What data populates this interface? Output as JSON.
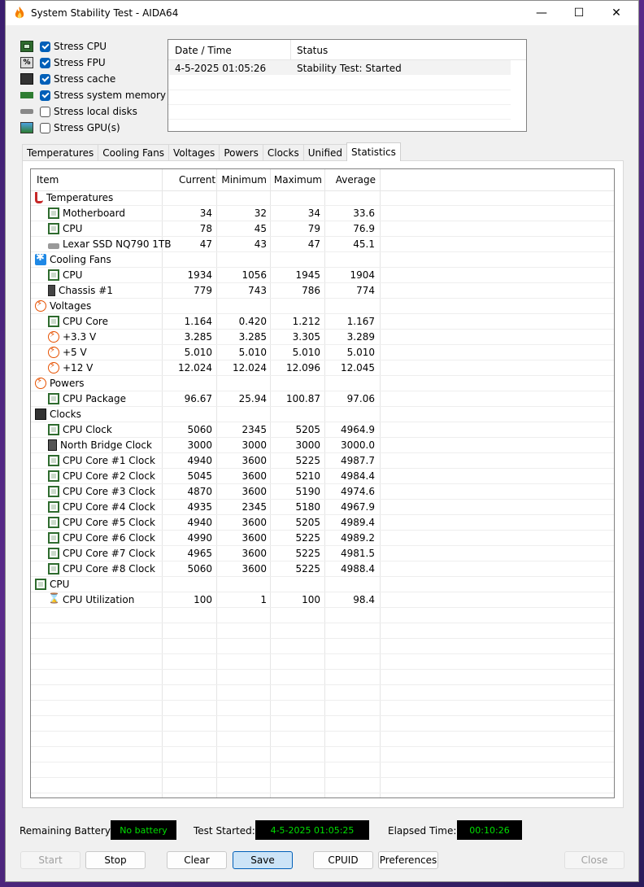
{
  "window": {
    "title": "System Stability Test - AIDA64",
    "min_glyph": "—",
    "max_glyph": "☐",
    "close_glyph": "✕"
  },
  "stress": [
    {
      "label": "Stress CPU",
      "checked": true,
      "icon": "cpu-chip-icon"
    },
    {
      "label": "Stress FPU",
      "checked": true,
      "icon": "fpu-icon"
    },
    {
      "label": "Stress cache",
      "checked": true,
      "icon": "cache-icon"
    },
    {
      "label": "Stress system memory",
      "checked": true,
      "icon": "memory-icon"
    },
    {
      "label": "Stress local disks",
      "checked": false,
      "icon": "disk-icon"
    },
    {
      "label": "Stress GPU(s)",
      "checked": false,
      "icon": "gpu-icon"
    }
  ],
  "status_table": {
    "headers": [
      "Date / Time",
      "Status"
    ],
    "rows": [
      {
        "datetime": "4-5-2025 01:05:26",
        "status": "Stability Test: Started"
      }
    ]
  },
  "tabs": [
    "Temperatures",
    "Cooling Fans",
    "Voltages",
    "Powers",
    "Clocks",
    "Unified",
    "Statistics"
  ],
  "active_tab": "Statistics",
  "stats": {
    "headers": [
      "Item",
      "Current",
      "Minimum",
      "Maximum",
      "Average"
    ],
    "rows": [
      {
        "name": "Temperatures",
        "icon": "therm",
        "indent": 0
      },
      {
        "name": "Motherboard",
        "icon": "chip",
        "indent": 1,
        "cur": "34",
        "min": "32",
        "max": "34",
        "avg": "33.6"
      },
      {
        "name": "CPU",
        "icon": "chip",
        "indent": 1,
        "cur": "78",
        "min": "45",
        "max": "79",
        "avg": "76.9"
      },
      {
        "name": "Lexar SSD NQ790 1TB",
        "icon": "disk",
        "indent": 1,
        "cur": "47",
        "min": "43",
        "max": "47",
        "avg": "45.1"
      },
      {
        "name": "Cooling Fans",
        "icon": "fan",
        "indent": 0
      },
      {
        "name": "CPU",
        "icon": "chip",
        "indent": 1,
        "cur": "1934",
        "min": "1056",
        "max": "1945",
        "avg": "1904"
      },
      {
        "name": "Chassis #1",
        "icon": "case",
        "indent": 1,
        "cur": "779",
        "min": "743",
        "max": "786",
        "avg": "774"
      },
      {
        "name": "Voltages",
        "icon": "bolt",
        "indent": 0
      },
      {
        "name": "CPU Core",
        "icon": "chip",
        "indent": 1,
        "cur": "1.164",
        "min": "0.420",
        "max": "1.212",
        "avg": "1.167"
      },
      {
        "name": "+3.3 V",
        "icon": "bolt",
        "indent": 1,
        "cur": "3.285",
        "min": "3.285",
        "max": "3.305",
        "avg": "3.289"
      },
      {
        "name": "+5 V",
        "icon": "bolt",
        "indent": 1,
        "cur": "5.010",
        "min": "5.010",
        "max": "5.010",
        "avg": "5.010"
      },
      {
        "name": "+12 V",
        "icon": "bolt",
        "indent": 1,
        "cur": "12.024",
        "min": "12.024",
        "max": "12.096",
        "avg": "12.045"
      },
      {
        "name": "Powers",
        "icon": "bolt",
        "indent": 0
      },
      {
        "name": "CPU Package",
        "icon": "chip",
        "indent": 1,
        "cur": "96.67",
        "min": "25.94",
        "max": "100.87",
        "avg": "97.06"
      },
      {
        "name": "Clocks",
        "icon": "clk",
        "indent": 0
      },
      {
        "name": "CPU Clock",
        "icon": "chip",
        "indent": 1,
        "cur": "5060",
        "min": "2345",
        "max": "5205",
        "avg": "4964.9"
      },
      {
        "name": "North Bridge Clock",
        "icon": "nb",
        "indent": 1,
        "cur": "3000",
        "min": "3000",
        "max": "3000",
        "avg": "3000.0"
      },
      {
        "name": "CPU Core #1 Clock",
        "icon": "chip",
        "indent": 1,
        "cur": "4940",
        "min": "3600",
        "max": "5225",
        "avg": "4987.7"
      },
      {
        "name": "CPU Core #2 Clock",
        "icon": "chip",
        "indent": 1,
        "cur": "5045",
        "min": "3600",
        "max": "5210",
        "avg": "4984.4"
      },
      {
        "name": "CPU Core #3 Clock",
        "icon": "chip",
        "indent": 1,
        "cur": "4870",
        "min": "3600",
        "max": "5190",
        "avg": "4974.6"
      },
      {
        "name": "CPU Core #4 Clock",
        "icon": "chip",
        "indent": 1,
        "cur": "4935",
        "min": "2345",
        "max": "5180",
        "avg": "4967.9"
      },
      {
        "name": "CPU Core #5 Clock",
        "icon": "chip",
        "indent": 1,
        "cur": "4940",
        "min": "3600",
        "max": "5205",
        "avg": "4989.4"
      },
      {
        "name": "CPU Core #6 Clock",
        "icon": "chip",
        "indent": 1,
        "cur": "4990",
        "min": "3600",
        "max": "5225",
        "avg": "4989.2"
      },
      {
        "name": "CPU Core #7 Clock",
        "icon": "chip",
        "indent": 1,
        "cur": "4965",
        "min": "3600",
        "max": "5225",
        "avg": "4981.5"
      },
      {
        "name": "CPU Core #8 Clock",
        "icon": "chip",
        "indent": 1,
        "cur": "5060",
        "min": "3600",
        "max": "5225",
        "avg": "4988.4"
      },
      {
        "name": "CPU",
        "icon": "chip",
        "indent": 0
      },
      {
        "name": "CPU Utilization",
        "icon": "hour",
        "indent": 1,
        "cur": "100",
        "min": "1",
        "max": "100",
        "avg": "98.4"
      }
    ]
  },
  "footer": {
    "battery_label": "Remaining Battery:",
    "battery_value": "No battery",
    "started_label": "Test Started:",
    "started_value": "4-5-2025 01:05:25",
    "elapsed_label": "Elapsed Time:",
    "elapsed_value": "00:10:26"
  },
  "buttons": {
    "start": "Start",
    "stop": "Stop",
    "clear": "Clear",
    "save": "Save",
    "cpuid": "CPUID",
    "preferences": "Preferences",
    "close": "Close"
  },
  "colors": {
    "accent": "#005fb8",
    "lcd_text": "#00e000"
  }
}
